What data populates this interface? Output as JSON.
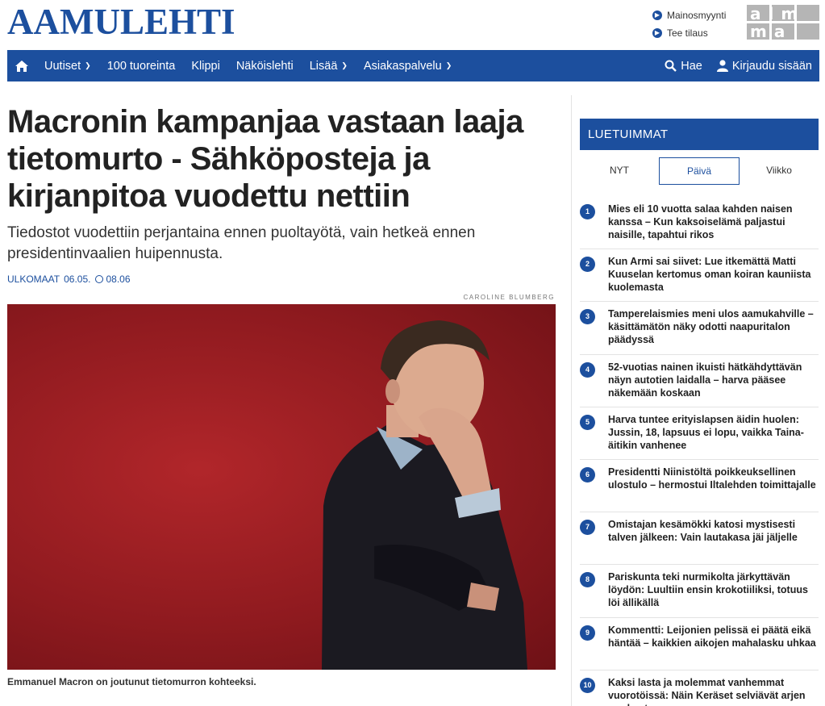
{
  "header": {
    "logo": "AAMULEHTI",
    "links": [
      {
        "icon": "arrow-circle-icon",
        "label": "Mainosmyynti"
      },
      {
        "icon": "arrow-circle-icon",
        "label": "Tee tilaus"
      }
    ],
    "brand_logo": "almamedia-logo"
  },
  "nav": {
    "items": [
      {
        "label": "Uutiset",
        "dropdown": true
      },
      {
        "label": "100 tuoreinta",
        "dropdown": false
      },
      {
        "label": "Klippi",
        "dropdown": false
      },
      {
        "label": "Näköislehti",
        "dropdown": false
      },
      {
        "label": "Lisää",
        "dropdown": true
      },
      {
        "label": "Asiakaspalvelu",
        "dropdown": true
      }
    ],
    "search": "Hae",
    "login": "Kirjaudu sisään"
  },
  "article": {
    "headline": "Macronin kampanjaa vastaan laaja tietomurto - Sähköposteja ja kirjanpitoa vuodettu nettiin",
    "lead": "Tiedostot vuodettiin perjantaina ennen puoltayötä, vain hetkeä ennen presidentinvaalien huipennusta.",
    "category": "ULKOMAAT",
    "date": "06.05.",
    "time": "08.06",
    "photo_credit": "CAROLINE BLUMBERG",
    "caption": "Emmanuel Macron on joutunut tietomurron kohteeksi."
  },
  "sidebar": {
    "title": "LUETUIMMAT",
    "tabs": [
      {
        "label": "NYT",
        "active": false
      },
      {
        "label": "Päivä",
        "active": true
      },
      {
        "label": "Viikko",
        "active": false
      }
    ],
    "items": [
      {
        "num": "1",
        "text": "Mies eli 10 vuotta salaa kahden naisen kanssa – Kun kaksoiselämä paljastui naisille, tapahtui rikos"
      },
      {
        "num": "2",
        "text": "Kun Armi sai siivet: Lue itkemättä Matti Kuuselan kertomus oman koiran kauniista kuolemasta"
      },
      {
        "num": "3",
        "text": "Tamperelaismies meni ulos aamukahville – käsittämätön näky odotti naapuritalon päädyssä"
      },
      {
        "num": "4",
        "text": "52-vuotias nainen ikuisti hätkähdyttävän näyn autotien laidalla – harva pääsee näkemään koskaan"
      },
      {
        "num": "5",
        "text": "Harva tuntee erityislapsen äidin huolen: Jussin, 18, lapsuus ei lopu, vaikka Taina-äitikin vanhenee"
      },
      {
        "num": "6",
        "text": "Presidentti Niinistöltä poikkeuksellinen ulostulo – hermostui Iltalehden toimittajalle"
      },
      {
        "num": "7",
        "text": "Omistajan kesämökki katosi mystisesti talven jälkeen: Vain lautakasa jäi jäljelle"
      },
      {
        "num": "8",
        "text": "Pariskunta teki nurmikolta järkyttävän löydön: Luultiin ensin krokotiiliksi, totuus löi ällikällä"
      },
      {
        "num": "9",
        "text": "Kommentti: Leijonien pelissä ei päätä eikä häntää – kaikkien aikojen mahalasku uhkaa"
      },
      {
        "num": "10",
        "text": "Kaksi lasta ja molemmat vanhemmat vuorotöissä: Näin Keräset selviävät arjen rumbasta"
      }
    ]
  },
  "colors": {
    "brand": "#1c4f9e",
    "photo_bg": "#9b1d22"
  }
}
